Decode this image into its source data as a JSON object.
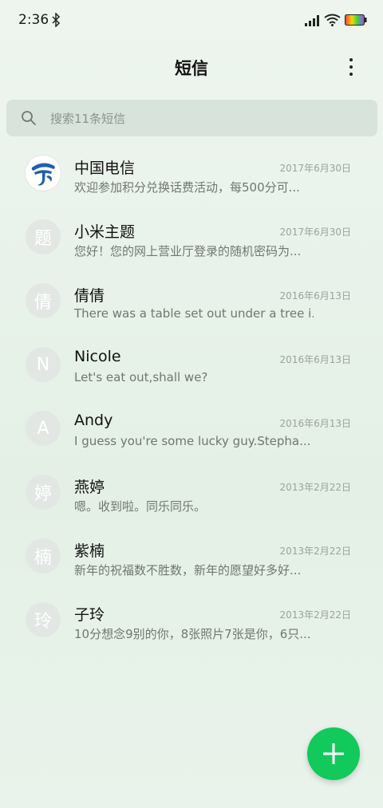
{
  "status_bar": {
    "time": "2:36",
    "icons": [
      "bluetooth-icon",
      "signal-icon",
      "wifi-icon",
      "battery-icon"
    ]
  },
  "header": {
    "title": "短信",
    "more_icon": "more-vertical-icon"
  },
  "search": {
    "placeholder": "搜索11条短信",
    "icon": "search-icon"
  },
  "conversations": [
    {
      "name": "中国电信",
      "avatar": "",
      "avatar_type": "logo",
      "date": "2017年6月30日",
      "snippet": "欢迎参加积分兑换话费活动，每500分可..."
    },
    {
      "name": "小米主题",
      "avatar": "题",
      "avatar_type": "letter",
      "date": "2017年6月30日",
      "snippet": "您好！您的网上营业厅登录的随机密码为..."
    },
    {
      "name": "倩倩",
      "avatar": "倩",
      "avatar_type": "letter",
      "date": "2016年6月13日",
      "snippet": "There was a table set out under a tree i..."
    },
    {
      "name": "Nicole",
      "avatar": "N",
      "avatar_type": "letter",
      "date": "2016年6月13日",
      "snippet": "Let's eat out,shall we?"
    },
    {
      "name": "Andy",
      "avatar": "A",
      "avatar_type": "letter",
      "date": "2016年6月13日",
      "snippet": "I guess you're some lucky guy.Stepha..."
    },
    {
      "name": "燕婷",
      "avatar": "婷",
      "avatar_type": "letter",
      "date": "2013年2月22日",
      "snippet": "嗯。收到啦。同乐同乐。"
    },
    {
      "name": "紫楠",
      "avatar": "楠",
      "avatar_type": "letter",
      "date": "2013年2月22日",
      "snippet": "新年的祝福数不胜数，新年的愿望好多好..."
    },
    {
      "name": "子玲",
      "avatar": "玲",
      "avatar_type": "letter",
      "date": "2013年2月22日",
      "snippet": "10分想念9别的你，8张照片7张是你，6只..."
    }
  ],
  "fab": {
    "icon": "plus-icon"
  },
  "colors": {
    "accent": "#12c95c",
    "background": "#e9f3eb",
    "avatar_bg": "#e3e7e4",
    "telecom_blue": "#1f5fb0"
  }
}
